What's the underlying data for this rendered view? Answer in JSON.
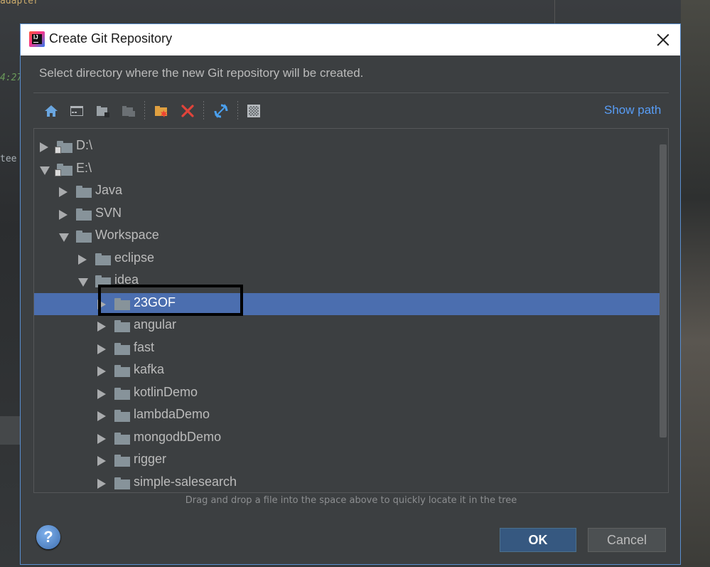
{
  "background": {
    "code_fragments": [
      "adapter",
      "4:27",
      "tee"
    ]
  },
  "dialog": {
    "title": "Create Git Repository",
    "app_icon": "intellij-idea-icon",
    "description": "Select directory where the new Git repository will be created.",
    "show_path_label": "Show path",
    "toolbar": [
      {
        "name": "home-icon",
        "title": "Home"
      },
      {
        "name": "desktop-icon",
        "title": "Desktop"
      },
      {
        "name": "project-icon",
        "title": "Project"
      },
      {
        "name": "module-icon",
        "title": "Module"
      },
      {
        "name": "new-folder-icon",
        "title": "New Folder"
      },
      {
        "name": "delete-icon",
        "title": "Delete"
      },
      {
        "name": "refresh-icon",
        "title": "Refresh"
      },
      {
        "name": "hidden-files-icon",
        "title": "Show Hidden Files"
      }
    ],
    "tree": [
      {
        "label": "D:\\",
        "level": 0,
        "expanded": false,
        "drive": true
      },
      {
        "label": "E:\\",
        "level": 0,
        "expanded": true,
        "drive": true
      },
      {
        "label": "Java",
        "level": 1,
        "expanded": false
      },
      {
        "label": "SVN",
        "level": 1,
        "expanded": false
      },
      {
        "label": "Workspace",
        "level": 1,
        "expanded": true
      },
      {
        "label": "eclipse",
        "level": 2,
        "expanded": false
      },
      {
        "label": "idea",
        "level": 2,
        "expanded": true
      },
      {
        "label": "23GOF",
        "level": 3,
        "expanded": false,
        "selected": true
      },
      {
        "label": "angular",
        "level": 3,
        "expanded": false
      },
      {
        "label": "fast",
        "level": 3,
        "expanded": false
      },
      {
        "label": "kafka",
        "level": 3,
        "expanded": false
      },
      {
        "label": "kotlinDemo",
        "level": 3,
        "expanded": false
      },
      {
        "label": "lambdaDemo",
        "level": 3,
        "expanded": false
      },
      {
        "label": "mongodbDemo",
        "level": 3,
        "expanded": false
      },
      {
        "label": "rigger",
        "level": 3,
        "expanded": false
      },
      {
        "label": "simple-salesearch",
        "level": 3,
        "expanded": false
      }
    ],
    "hint": "Drag and drop a file into the space above to quickly locate it in the tree",
    "help_label": "?",
    "ok_label": "OK",
    "cancel_label": "Cancel"
  },
  "colors": {
    "accent": "#4b6eaf",
    "link": "#589df6",
    "dialog_bg": "#3c3f41"
  }
}
